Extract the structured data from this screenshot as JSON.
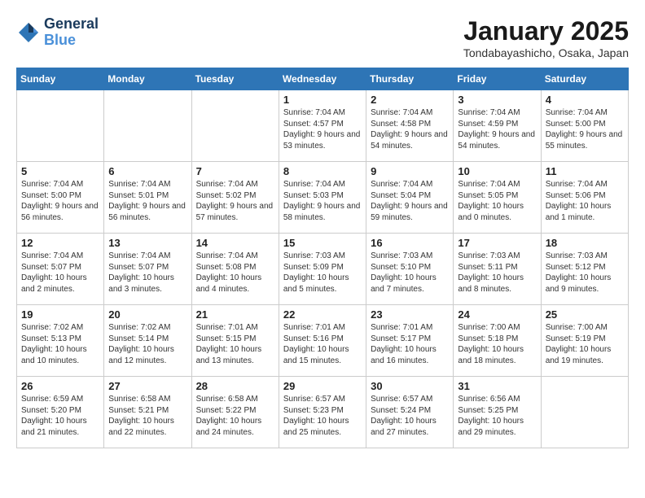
{
  "header": {
    "logo_line1": "General",
    "logo_line2": "Blue",
    "month_title": "January 2025",
    "location": "Tondabayashicho, Osaka, Japan"
  },
  "weekdays": [
    "Sunday",
    "Monday",
    "Tuesday",
    "Wednesday",
    "Thursday",
    "Friday",
    "Saturday"
  ],
  "weeks": [
    [
      {
        "day": "",
        "info": ""
      },
      {
        "day": "",
        "info": ""
      },
      {
        "day": "",
        "info": ""
      },
      {
        "day": "1",
        "info": "Sunrise: 7:04 AM\nSunset: 4:57 PM\nDaylight: 9 hours and 53 minutes."
      },
      {
        "day": "2",
        "info": "Sunrise: 7:04 AM\nSunset: 4:58 PM\nDaylight: 9 hours and 54 minutes."
      },
      {
        "day": "3",
        "info": "Sunrise: 7:04 AM\nSunset: 4:59 PM\nDaylight: 9 hours and 54 minutes."
      },
      {
        "day": "4",
        "info": "Sunrise: 7:04 AM\nSunset: 5:00 PM\nDaylight: 9 hours and 55 minutes."
      }
    ],
    [
      {
        "day": "5",
        "info": "Sunrise: 7:04 AM\nSunset: 5:00 PM\nDaylight: 9 hours and 56 minutes."
      },
      {
        "day": "6",
        "info": "Sunrise: 7:04 AM\nSunset: 5:01 PM\nDaylight: 9 hours and 56 minutes."
      },
      {
        "day": "7",
        "info": "Sunrise: 7:04 AM\nSunset: 5:02 PM\nDaylight: 9 hours and 57 minutes."
      },
      {
        "day": "8",
        "info": "Sunrise: 7:04 AM\nSunset: 5:03 PM\nDaylight: 9 hours and 58 minutes."
      },
      {
        "day": "9",
        "info": "Sunrise: 7:04 AM\nSunset: 5:04 PM\nDaylight: 9 hours and 59 minutes."
      },
      {
        "day": "10",
        "info": "Sunrise: 7:04 AM\nSunset: 5:05 PM\nDaylight: 10 hours and 0 minutes."
      },
      {
        "day": "11",
        "info": "Sunrise: 7:04 AM\nSunset: 5:06 PM\nDaylight: 10 hours and 1 minute."
      }
    ],
    [
      {
        "day": "12",
        "info": "Sunrise: 7:04 AM\nSunset: 5:07 PM\nDaylight: 10 hours and 2 minutes."
      },
      {
        "day": "13",
        "info": "Sunrise: 7:04 AM\nSunset: 5:07 PM\nDaylight: 10 hours and 3 minutes."
      },
      {
        "day": "14",
        "info": "Sunrise: 7:04 AM\nSunset: 5:08 PM\nDaylight: 10 hours and 4 minutes."
      },
      {
        "day": "15",
        "info": "Sunrise: 7:03 AM\nSunset: 5:09 PM\nDaylight: 10 hours and 5 minutes."
      },
      {
        "day": "16",
        "info": "Sunrise: 7:03 AM\nSunset: 5:10 PM\nDaylight: 10 hours and 7 minutes."
      },
      {
        "day": "17",
        "info": "Sunrise: 7:03 AM\nSunset: 5:11 PM\nDaylight: 10 hours and 8 minutes."
      },
      {
        "day": "18",
        "info": "Sunrise: 7:03 AM\nSunset: 5:12 PM\nDaylight: 10 hours and 9 minutes."
      }
    ],
    [
      {
        "day": "19",
        "info": "Sunrise: 7:02 AM\nSunset: 5:13 PM\nDaylight: 10 hours and 10 minutes."
      },
      {
        "day": "20",
        "info": "Sunrise: 7:02 AM\nSunset: 5:14 PM\nDaylight: 10 hours and 12 minutes."
      },
      {
        "day": "21",
        "info": "Sunrise: 7:01 AM\nSunset: 5:15 PM\nDaylight: 10 hours and 13 minutes."
      },
      {
        "day": "22",
        "info": "Sunrise: 7:01 AM\nSunset: 5:16 PM\nDaylight: 10 hours and 15 minutes."
      },
      {
        "day": "23",
        "info": "Sunrise: 7:01 AM\nSunset: 5:17 PM\nDaylight: 10 hours and 16 minutes."
      },
      {
        "day": "24",
        "info": "Sunrise: 7:00 AM\nSunset: 5:18 PM\nDaylight: 10 hours and 18 minutes."
      },
      {
        "day": "25",
        "info": "Sunrise: 7:00 AM\nSunset: 5:19 PM\nDaylight: 10 hours and 19 minutes."
      }
    ],
    [
      {
        "day": "26",
        "info": "Sunrise: 6:59 AM\nSunset: 5:20 PM\nDaylight: 10 hours and 21 minutes."
      },
      {
        "day": "27",
        "info": "Sunrise: 6:58 AM\nSunset: 5:21 PM\nDaylight: 10 hours and 22 minutes."
      },
      {
        "day": "28",
        "info": "Sunrise: 6:58 AM\nSunset: 5:22 PM\nDaylight: 10 hours and 24 minutes."
      },
      {
        "day": "29",
        "info": "Sunrise: 6:57 AM\nSunset: 5:23 PM\nDaylight: 10 hours and 25 minutes."
      },
      {
        "day": "30",
        "info": "Sunrise: 6:57 AM\nSunset: 5:24 PM\nDaylight: 10 hours and 27 minutes."
      },
      {
        "day": "31",
        "info": "Sunrise: 6:56 AM\nSunset: 5:25 PM\nDaylight: 10 hours and 29 minutes."
      },
      {
        "day": "",
        "info": ""
      }
    ]
  ]
}
